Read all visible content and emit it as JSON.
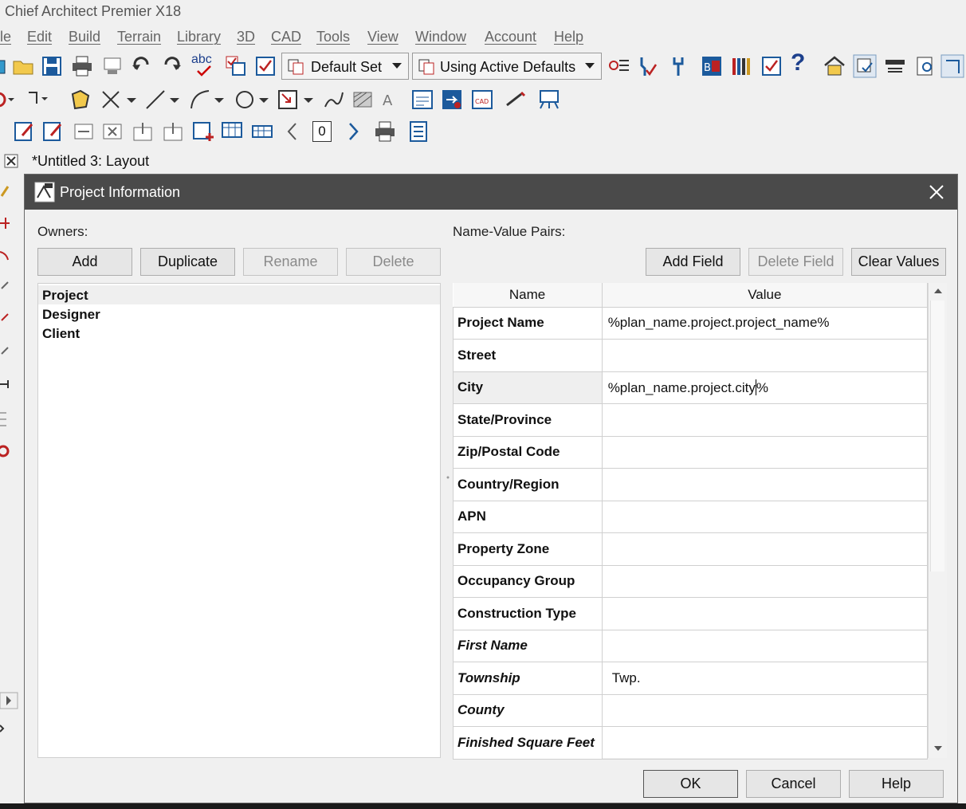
{
  "window": {
    "title": "Chief Architect Premier X18"
  },
  "menu": [
    "le",
    "Edit",
    "Build",
    "Terrain",
    "Library",
    "3D",
    "CAD",
    "Tools",
    "View",
    "Window",
    "Account",
    "Help"
  ],
  "toolbar": {
    "default_set": "Default Set",
    "active_defaults": "Using Active Defaults",
    "page_number": "0",
    "abc_label": "abc"
  },
  "document_tab": {
    "title": "*Untitled 3: Layout"
  },
  "dialog": {
    "title": "Project Information",
    "owners_label": "Owners:",
    "pairs_label": "Name-Value Pairs:",
    "buttons": {
      "add": "Add",
      "duplicate": "Duplicate",
      "rename": "Rename",
      "delete": "Delete",
      "add_field": "Add Field",
      "delete_field": "Delete Field",
      "clear_values": "Clear Values",
      "ok": "OK",
      "cancel": "Cancel",
      "help": "Help"
    },
    "owners": [
      "Project",
      "Designer",
      "Client"
    ],
    "columns": {
      "name": "Name",
      "value": "Value"
    },
    "rows": [
      {
        "name": "Project Name",
        "value": "%plan_name.project.project_name%"
      },
      {
        "name": "Street",
        "value": ""
      },
      {
        "name": "City",
        "value": "%plan_name.project.city%"
      },
      {
        "name": "State/Province",
        "value": ""
      },
      {
        "name": "Zip/Postal Code",
        "value": ""
      },
      {
        "name": "Country/Region",
        "value": ""
      },
      {
        "name": "APN",
        "value": ""
      },
      {
        "name": "Property Zone",
        "value": ""
      },
      {
        "name": "Occupancy Group",
        "value": ""
      },
      {
        "name": "Construction Type",
        "value": ""
      },
      {
        "name": "First Name",
        "value": ""
      },
      {
        "name": "Township",
        "value": "Twp."
      },
      {
        "name": "County",
        "value": ""
      },
      {
        "name": "Finished Square Feet",
        "value": ""
      }
    ],
    "city_value_before_caret": "%plan_name.project.city",
    "city_value_after_caret": "%"
  },
  "colors": {
    "dialog_title_bg": "#4a4a4a",
    "selected_row": "#efefef"
  }
}
